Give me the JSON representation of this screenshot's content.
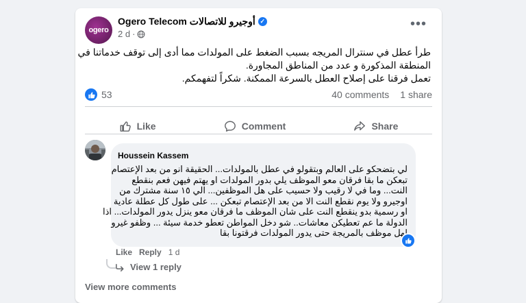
{
  "post": {
    "page_name": "Ogero Telecom أوجيرو للاتصالات",
    "avatar_text": "ogero",
    "time": "2 d",
    "separator": "·",
    "text_lines": [
      "طرأ عطل في سنترال المريجه بسبب الضغط على المولدات مما أدى إلى توقف خدماتنا في",
      "المنطقة المذكورة و عدد من المناطق المجاورة.",
      "تعمل فرقنا على إصلاح العطل بالسرعة الممكنة. شكراً لتفهمكم."
    ],
    "reactions_count": "53",
    "comments_count": "40 comments",
    "shares_count": "1 share"
  },
  "actions": {
    "like": "Like",
    "comment": "Comment",
    "share": "Share"
  },
  "comment": {
    "author": "Houssein Kassem",
    "text_lines": [
      "لي بتضحكو على العالم وبتقولو في عطل بالمولدات... الحقيقة انو من بعد الإعتصام",
      "تبعكن ما بقا فرقان معو الموظف يلي بدور المولدات او يهتم فيهن فعم بنقطع",
      "النت... وما في لا رقيب ولا حسيب على هل الموظفين... الي ١٥ سنة مشترك من",
      "اوجيرو ولا يوم نقطع النت الا من بعد الإعتصام تبعكن ... على طول كل عطلة عادية",
      "او رسمية بدو ينقطع النت على شان الموظف ما فرقان معو ينزل يدور المولدات... اذا",
      "الدولة ما عم تعطيكن معاشات.. شو دخل المواطن تعطو خدمة سيئة ... وظفو غيرو",
      "لهل موظف بالمريجة حتى يدور المولدات فرقتونا بقا"
    ],
    "like_label": "Like",
    "reply_label": "Reply",
    "time": "1 d",
    "view_replies": "View 1 reply"
  },
  "footer": {
    "view_more": "View more comments"
  },
  "colors": {
    "accent": "#1877f2",
    "secondary_text": "#65676b",
    "bubble": "#f0f2f5",
    "brand_purple": "#8a2a7e"
  }
}
